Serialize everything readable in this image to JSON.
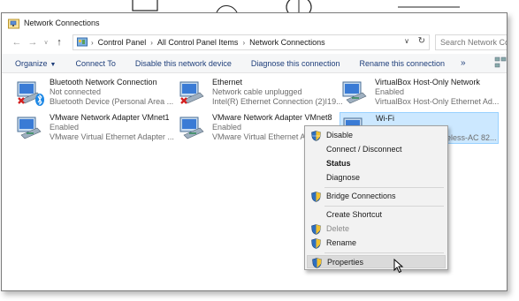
{
  "window": {
    "title": "Network Connections"
  },
  "address": {
    "crumbs": [
      "Control Panel",
      "All Control Panel Items",
      "Network Connections"
    ],
    "search_placeholder": "Search Network Conn"
  },
  "toolbar": {
    "organize": "Organize",
    "connect_to": "Connect To",
    "disable": "Disable this network device",
    "diagnose": "Diagnose this connection",
    "rename": "Rename this connection",
    "more": "»"
  },
  "connections": [
    {
      "name": "Bluetooth Network Connection",
      "status": "Not connected",
      "device": "Bluetooth Device (Personal Area ..."
    },
    {
      "name": "Ethernet",
      "status": "Network cable unplugged",
      "device": "Intel(R) Ethernet Connection (2)I19..."
    },
    {
      "name": "VirtualBox Host-Only Network",
      "status": "Enabled",
      "device": "VirtualBox Host-Only Ethernet Ad..."
    },
    {
      "name": "VMware Network Adapter VMnet1",
      "status": "Enabled",
      "device": "VMware Virtual Ethernet Adapter ..."
    },
    {
      "name": "VMware Network Adapter VMnet8",
      "status": "Enabled",
      "device": "VMware Virtual Ethernet Adapter ..."
    },
    {
      "name": "Wi-Fi",
      "status": "",
      "device": "eless-AC 82..."
    }
  ],
  "context_menu": {
    "disable": "Disable",
    "connect": "Connect / Disconnect",
    "status": "Status",
    "diagnose": "Diagnose",
    "bridge": "Bridge Connections",
    "shortcut": "Create Shortcut",
    "delete": "Delete",
    "rename": "Rename",
    "properties": "Properties"
  },
  "colors": {
    "accent_link": "#1e3e7a",
    "selection": "#cce8ff",
    "error_red": "#d42020",
    "bluetooth": "#1e88e5"
  }
}
